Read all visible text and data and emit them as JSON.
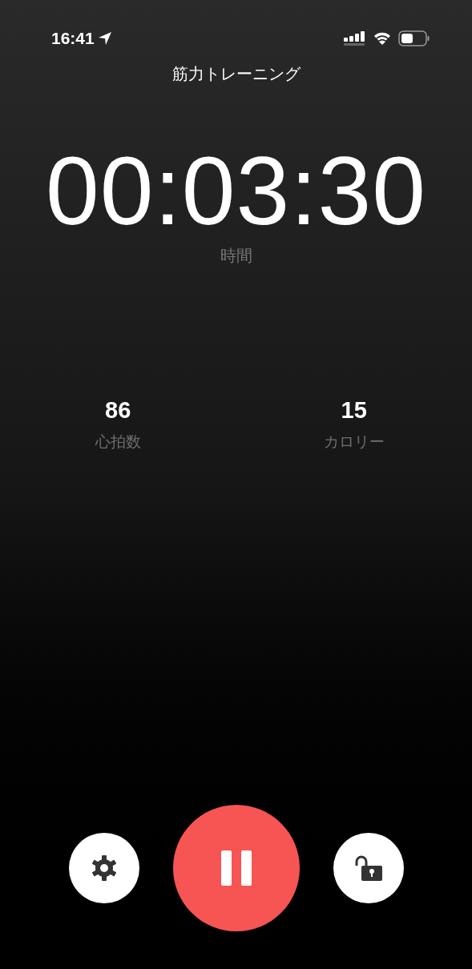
{
  "status_bar": {
    "time": "16:41"
  },
  "title": "筋力トレーニング",
  "timer": {
    "value": "00:03:30",
    "label": "時間"
  },
  "stats": [
    {
      "value": "86",
      "label": "心拍数"
    },
    {
      "value": "15",
      "label": "カロリー"
    }
  ]
}
